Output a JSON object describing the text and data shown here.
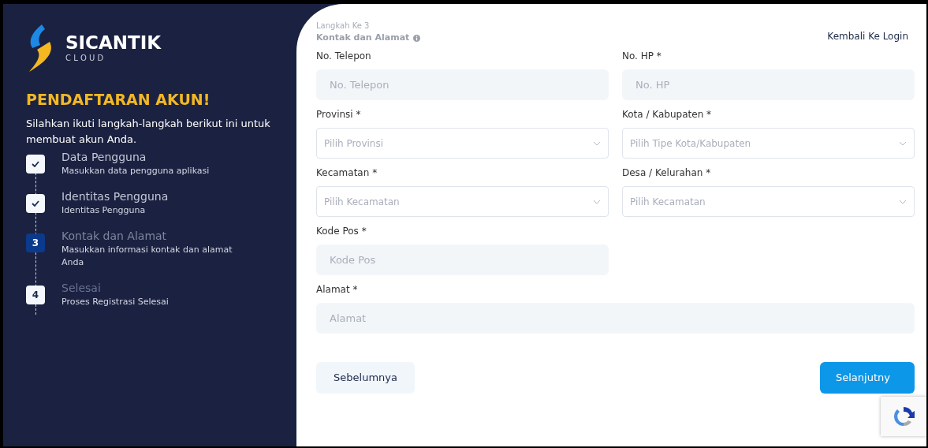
{
  "brand": {
    "name": "SICANTIK",
    "sub": "C L O U D"
  },
  "sidebar": {
    "title": "PENDAFTARAN AKUN!",
    "intro": "Silahkan ikuti langkah-langkah berikut ini untuk membuat akun Anda.",
    "steps": [
      {
        "kind": "done",
        "selected": false,
        "title": "Data Pengguna",
        "desc": "Masukkan data pengguna aplikasi"
      },
      {
        "kind": "done",
        "selected": false,
        "title": "Identitas Pengguna",
        "desc": "Identitas Pengguna"
      },
      {
        "kind": "numbered",
        "selected": true,
        "marker": "3",
        "title": "Kontak dan Alamat",
        "desc": "Masukkan informasi kontak dan alamat Anda"
      },
      {
        "kind": "numbered",
        "selected": false,
        "marker": "4",
        "title": "Selesai",
        "desc": "Proses Registrasi Selesai"
      }
    ]
  },
  "header": {
    "step": "Langkah Ke 3",
    "title": "Kontak dan Alamat",
    "back_link": "Kembali Ke Login"
  },
  "fields": [
    {
      "kind": "input",
      "label": "No. Telepon",
      "placeholder": "No. Telepon"
    },
    {
      "kind": "input",
      "label": "No. HP *",
      "placeholder": "No. HP"
    },
    {
      "kind": "select",
      "label": "Provinsi *",
      "placeholder": "Pilih Provinsi"
    },
    {
      "kind": "select",
      "label": "Kota / Kabupaten *",
      "placeholder": "Pilih Tipe Kota/Kabupaten"
    },
    {
      "kind": "select",
      "label": "Kecamatan *",
      "placeholder": "Pilih Kecamatan"
    },
    {
      "kind": "select",
      "label": "Desa / Kelurahan *",
      "placeholder": "Pilih Kecamatan"
    },
    {
      "kind": "input",
      "label": "Kode Pos *",
      "placeholder": "Kode Pos"
    },
    {
      "kind": "address",
      "label": "Alamat *",
      "placeholder": "Alamat"
    }
  ],
  "buttons": {
    "back": "Sebelumnya",
    "next": "Selanjutny"
  }
}
